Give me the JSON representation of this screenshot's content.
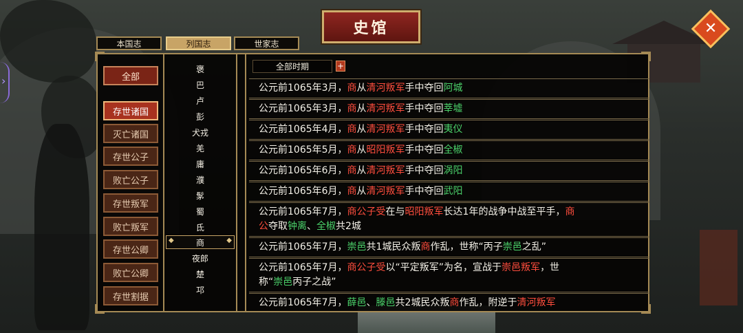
{
  "title": "史馆",
  "close_icon": "close-icon",
  "tabs": [
    "本国志",
    "列国志",
    "世家志"
  ],
  "active_tab": 1,
  "categories": [
    "全部",
    "存世诸国",
    "灭亡诸国",
    "存世公子",
    "败亡公子",
    "存世叛军",
    "败亡叛军",
    "存世公卿",
    "败亡公卿",
    "存世割据"
  ],
  "active_category": 1,
  "states": [
    "褒",
    "巴",
    "卢",
    "彭",
    "犬戎",
    "羌",
    "庸",
    "濮",
    "髳",
    "蜀",
    "氐",
    "商",
    "夜郎",
    "楚",
    "邛"
  ],
  "selected_state": 11,
  "filter": {
    "label": "全部时期",
    "add": "+"
  },
  "colors": {
    "red": "#ff4d3d",
    "green": "#4bd16a",
    "white": "#f4f1e8"
  },
  "records": [
    {
      "lines": [
        [
          {
            "t": "公元前1065年3月，",
            "c": "white"
          },
          {
            "t": "商",
            "c": "red"
          },
          {
            "t": "从",
            "c": "white"
          },
          {
            "t": "清河叛军",
            "c": "red"
          },
          {
            "t": "手中夺回",
            "c": "white"
          },
          {
            "t": "阿城",
            "c": "green"
          }
        ]
      ]
    },
    {
      "lines": [
        [
          {
            "t": "公元前1065年3月，",
            "c": "white"
          },
          {
            "t": "商",
            "c": "red"
          },
          {
            "t": "从",
            "c": "white"
          },
          {
            "t": "清河叛军",
            "c": "red"
          },
          {
            "t": "手中夺回",
            "c": "white"
          },
          {
            "t": "莘墟",
            "c": "green"
          }
        ]
      ]
    },
    {
      "lines": [
        [
          {
            "t": "公元前1065年4月，",
            "c": "white"
          },
          {
            "t": "商",
            "c": "red"
          },
          {
            "t": "从",
            "c": "white"
          },
          {
            "t": "清河叛军",
            "c": "red"
          },
          {
            "t": "手中夺回",
            "c": "white"
          },
          {
            "t": "夷仪",
            "c": "green"
          }
        ]
      ]
    },
    {
      "lines": [
        [
          {
            "t": "公元前1065年5月，",
            "c": "white"
          },
          {
            "t": "商",
            "c": "red"
          },
          {
            "t": "从",
            "c": "white"
          },
          {
            "t": "昭阳叛军",
            "c": "red"
          },
          {
            "t": "手中夺回",
            "c": "white"
          },
          {
            "t": "全椒",
            "c": "green"
          }
        ]
      ]
    },
    {
      "lines": [
        [
          {
            "t": "公元前1065年6月，",
            "c": "white"
          },
          {
            "t": "商",
            "c": "red"
          },
          {
            "t": "从",
            "c": "white"
          },
          {
            "t": "清河叛军",
            "c": "red"
          },
          {
            "t": "手中夺回",
            "c": "white"
          },
          {
            "t": "涡阳",
            "c": "green"
          }
        ]
      ]
    },
    {
      "lines": [
        [
          {
            "t": "公元前1065年6月，",
            "c": "white"
          },
          {
            "t": "商",
            "c": "red"
          },
          {
            "t": "从",
            "c": "white"
          },
          {
            "t": "清河叛军",
            "c": "red"
          },
          {
            "t": "手中夺回",
            "c": "white"
          },
          {
            "t": "武阳",
            "c": "green"
          }
        ]
      ]
    },
    {
      "lines": [
        [
          {
            "t": "公元前1065年7月，",
            "c": "white"
          },
          {
            "t": "商公子受",
            "c": "red"
          },
          {
            "t": "在与",
            "c": "white"
          },
          {
            "t": "昭阳叛军",
            "c": "red"
          },
          {
            "t": "长达1年的战争中战至平手，",
            "c": "white"
          },
          {
            "t": "商",
            "c": "red"
          }
        ],
        [
          {
            "t": "公",
            "c": "red"
          },
          {
            "t": "夺取",
            "c": "white"
          },
          {
            "t": "钟离",
            "c": "green"
          },
          {
            "t": "、",
            "c": "white"
          },
          {
            "t": "全椒",
            "c": "green"
          },
          {
            "t": "共2城",
            "c": "white"
          }
        ]
      ]
    },
    {
      "lines": [
        [
          {
            "t": "公元前1065年7月，",
            "c": "white"
          },
          {
            "t": "崇邑",
            "c": "green"
          },
          {
            "t": "共1城民众叛",
            "c": "white"
          },
          {
            "t": "商",
            "c": "red"
          },
          {
            "t": "作乱，世称“丙子",
            "c": "white"
          },
          {
            "t": "崇邑",
            "c": "green"
          },
          {
            "t": "之乱”",
            "c": "white"
          }
        ]
      ]
    },
    {
      "lines": [
        [
          {
            "t": "公元前1065年7月，",
            "c": "white"
          },
          {
            "t": "商公子受",
            "c": "red"
          },
          {
            "t": "以“平定叛军”为名，宣战于",
            "c": "white"
          },
          {
            "t": "崇邑叛军",
            "c": "red"
          },
          {
            "t": "，世",
            "c": "white"
          }
        ],
        [
          {
            "t": "称“",
            "c": "white"
          },
          {
            "t": "崇邑",
            "c": "green"
          },
          {
            "t": "丙子之战”",
            "c": "white"
          }
        ]
      ]
    },
    {
      "lines": [
        [
          {
            "t": "公元前1065年7月，",
            "c": "white"
          },
          {
            "t": "薛邑",
            "c": "green"
          },
          {
            "t": "、",
            "c": "white"
          },
          {
            "t": "滕邑",
            "c": "green"
          },
          {
            "t": "共2城民众叛",
            "c": "white"
          },
          {
            "t": "商",
            "c": "red"
          },
          {
            "t": "作乱，附逆于",
            "c": "white"
          },
          {
            "t": "清河叛军",
            "c": "red"
          }
        ]
      ]
    }
  ]
}
